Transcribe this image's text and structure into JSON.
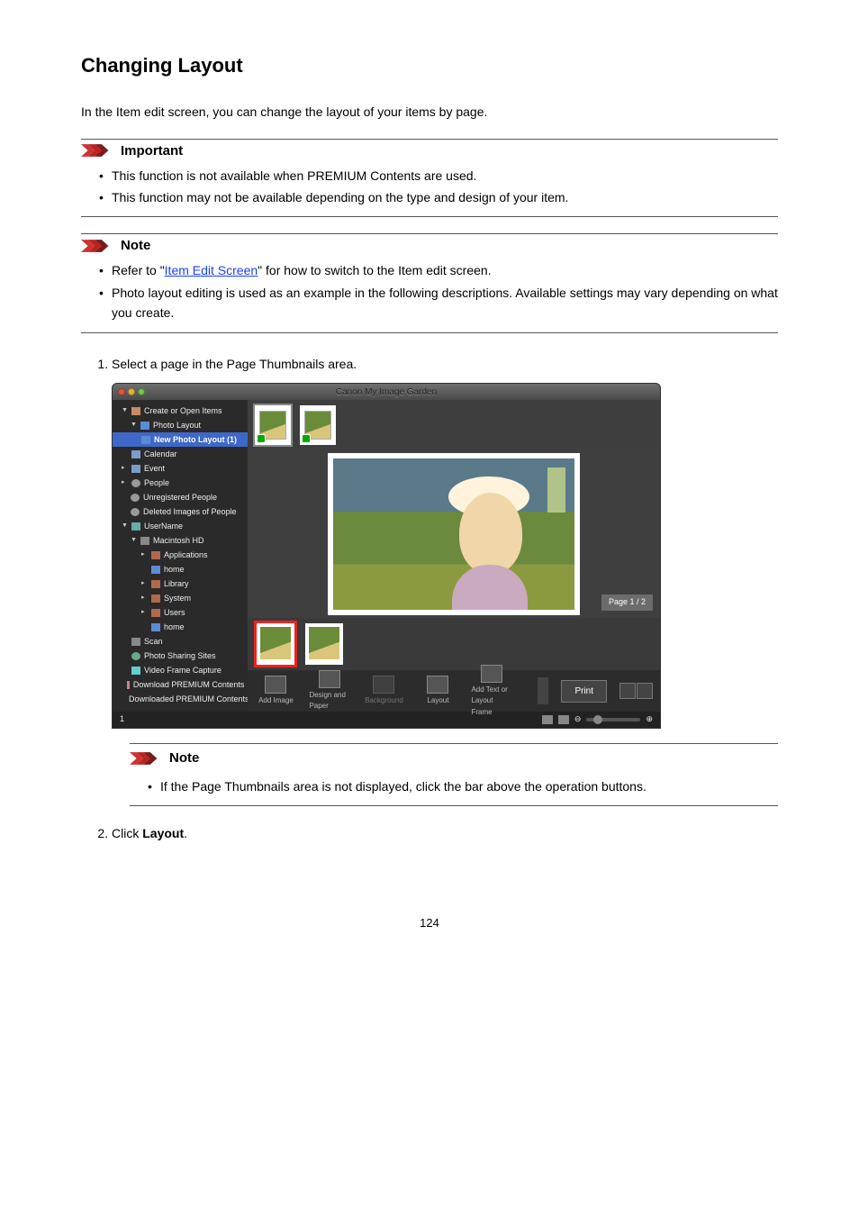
{
  "page_title": "Changing Layout",
  "intro": "In the Item edit screen, you can change the layout of your items by page.",
  "important": {
    "title": "Important",
    "items": [
      "This function is not available when PREMIUM Contents are used.",
      "This function may not be available depending on the type and design of your item."
    ]
  },
  "note_top": {
    "title": "Note",
    "refer_prefix": "Refer to \"",
    "refer_link": "Item Edit Screen",
    "refer_suffix": "\" for how to switch to the Item edit screen.",
    "item2": "Photo layout editing is used as an example in the following descriptions. Available settings may vary depending on what you create."
  },
  "step1": {
    "text": "Select a page in the Page Thumbnails area."
  },
  "note_inner": {
    "title": "Note",
    "items": [
      "If the Page Thumbnails area is not displayed, click the bar above the operation buttons."
    ]
  },
  "step2": {
    "prefix": "Click ",
    "strong": "Layout",
    "suffix": "."
  },
  "app": {
    "title": "Canon My Image Garden",
    "sidebar": {
      "create_open": "Create or Open Items",
      "photo_layout": "Photo Layout",
      "new_photo_layout": "New Photo Layout (1)",
      "calendar": "Calendar",
      "event": "Event",
      "people": "People",
      "unreg_people": "Unregistered People",
      "deleted_people": "Deleted Images of People",
      "username": "UserName",
      "mac_hd": "Macintosh HD",
      "applications": "Applications",
      "home1": "home",
      "library": "Library",
      "system": "System",
      "users": "Users",
      "home2": "home",
      "scan": "Scan",
      "photo_sites": "Photo Sharing Sites",
      "video_capture": "Video Frame Capture",
      "download_premium": "Download PREMIUM Contents",
      "downloaded_premium": "Downloaded PREMIUM Contents"
    },
    "page_indicator": "Page 1 / 2",
    "tools": {
      "add_image": "Add Image",
      "design_paper": "Design and Paper",
      "background": "Background",
      "layout": "Layout",
      "add_text": "Add Text or Layout Frame",
      "print": "Print"
    },
    "status_left": "1"
  },
  "page_number": "124"
}
